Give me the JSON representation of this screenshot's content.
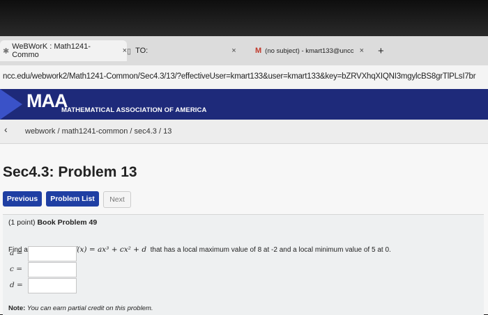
{
  "tabs": [
    {
      "label": "WeBWorK : Math1241-Commo",
      "close": "×"
    },
    {
      "label": "TO:",
      "close": "×"
    },
    {
      "label": "(no subject) - kmart133@uncc",
      "close": "×"
    }
  ],
  "new_tab": "+",
  "address_bar": {
    "url": "ncc.edu/webwork2/Math1241-Common/Sec4.3/13/?effectiveUser=kmart133&user=kmart133&key=bZRVXhqXIQNI3mgylcBS8grTlPLsI7br"
  },
  "header": {
    "logo": "MAA",
    "subtitle": "MATHEMATICAL ASSOCIATION OF AMERICA"
  },
  "breadcrumb": {
    "back": "‹",
    "path": "webwork / math1241-common / sec4.3 / 13"
  },
  "problem": {
    "title": "Sec4.3: Problem 13",
    "points": "(1 point)",
    "book": "Book Problem 49",
    "prompt_start": "Find a cubic function",
    "formula": "f(x) = ax³ + cx² + d",
    "prompt_end": "that has a local maximum value of 8 at -2 and a local minimum value of 5 at 0.",
    "answers": [
      {
        "label": "a =",
        "value": ""
      },
      {
        "label": "c =",
        "value": ""
      },
      {
        "label": "d =",
        "value": ""
      }
    ],
    "note_bold": "Note:",
    "note_text": "You can earn partial credit on this problem."
  },
  "nav_buttons": {
    "previous": "Previous",
    "problem_list": "Problem List",
    "next": "Next"
  }
}
